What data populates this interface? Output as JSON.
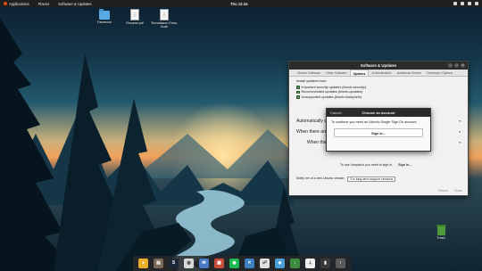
{
  "top_panel": {
    "applications": "Applications",
    "places": "Places",
    "active_app": "Software & Updates",
    "clock": "Thu 13:44"
  },
  "desktop_icons": [
    {
      "label": "Facebook",
      "icon": "folder-icon"
    },
    {
      "label": "Resume.pdf",
      "icon": "document-icon"
    },
    {
      "label": "Tecnoblaum Extra-Kuali",
      "icon": "document-icon"
    }
  ],
  "window": {
    "title": "Software & Updates",
    "tabs": [
      "Ubuntu Software",
      "Other Software",
      "Updates",
      "Authentication",
      "Additional Drivers",
      "Developer Options"
    ],
    "active_tab": "Updates",
    "install_label": "Install updates from:",
    "checks": [
      {
        "label": "Important security updates (bionic-security)",
        "checked": true
      },
      {
        "label": "Recommended updates (bionic-updates)",
        "checked": true
      },
      {
        "label": "Unsupported updates (bionic-backports)",
        "checked": true
      }
    ],
    "rows": [
      {
        "label": "Automatically check for updates:"
      },
      {
        "label": "When there are security updates:"
      },
      {
        "label": "When there are other updates:"
      }
    ],
    "livepatch_text": "To use Livepatch you need to sign in.",
    "livepatch_link": "Sign In...",
    "notify_label": "Notify me of a new Ubuntu version:",
    "notify_value": "For long-term support versions",
    "revert": "Revert",
    "close": "Close"
  },
  "dialog": {
    "cancel": "Cancel",
    "title": "Choose an account",
    "text": "To continue you need an Ubuntu Single Sign On account.",
    "button": "Sign In..."
  },
  "trash_label": "Trash",
  "dock": [
    {
      "name": "chrome-icon",
      "color": "#e8b02a",
      "glyph": "●"
    },
    {
      "name": "files-icon",
      "color": "#7a6a55",
      "glyph": "▤"
    },
    {
      "name": "steam-icon",
      "color": "#1b2838",
      "glyph": "S"
    },
    {
      "name": "vlc-icon",
      "color": "#d9d9d9",
      "glyph": "◍"
    },
    {
      "name": "mail-icon",
      "color": "#4a79c6",
      "glyph": "✉"
    },
    {
      "name": "calendar-icon",
      "color": "#c94b3a",
      "glyph": "▦"
    },
    {
      "name": "spotify-icon",
      "color": "#1db954",
      "glyph": "◉"
    },
    {
      "name": "tools-icon",
      "color": "#3e7fc1",
      "glyph": "✕"
    },
    {
      "name": "network-icon",
      "color": "#e0e0e0",
      "glyph": "☍"
    },
    {
      "name": "photos-icon",
      "color": "#4a9fd8",
      "glyph": "◈"
    },
    {
      "name": "torrent-icon",
      "color": "#3d8c3d",
      "glyph": "↓"
    },
    {
      "name": "thermometer-icon",
      "color": "#efefef",
      "glyph": "⊥"
    },
    {
      "name": "book-icon",
      "color": "#3a3a3a",
      "glyph": "▮"
    },
    {
      "name": "terminal-icon",
      "color": "#5a5a5a",
      "glyph": "›"
    }
  ]
}
